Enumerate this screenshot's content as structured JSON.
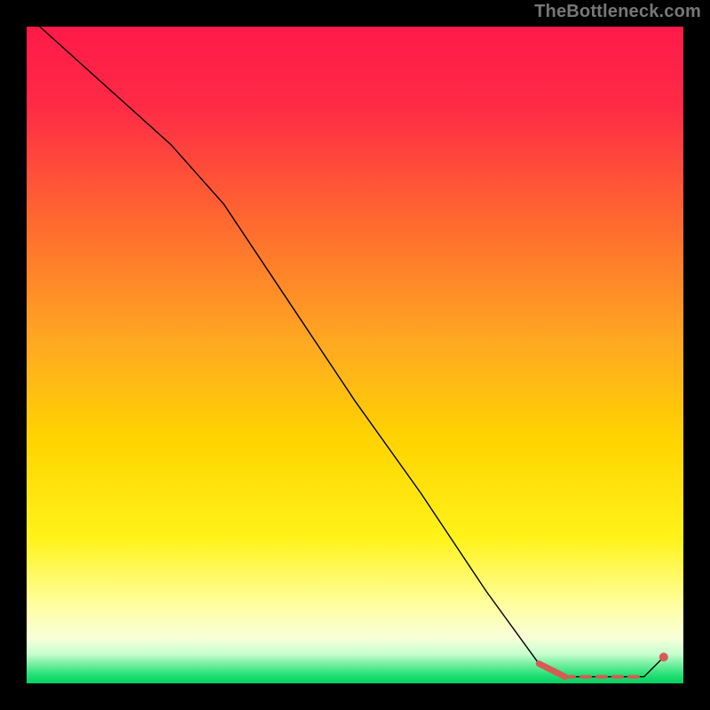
{
  "watermark": "TheBottleneck.com",
  "chart_data": {
    "type": "line",
    "title": "",
    "xlabel": "",
    "ylabel": "",
    "xlim": [
      0,
      100
    ],
    "ylim": [
      0,
      100
    ],
    "grid": false,
    "legend": false,
    "background_transition": {
      "from_color": "#ff1a48",
      "through_color": "#ffd400",
      "to_color": "#00e060",
      "bottom_band_approx_pct": 4
    },
    "series": [
      {
        "name": "curve",
        "type": "line",
        "x": [
          2,
          12,
          22,
          30,
          40,
          50,
          60,
          70,
          78,
          82,
          86,
          90,
          94,
          97
        ],
        "y": [
          100,
          91,
          82,
          73,
          58,
          43,
          29,
          14,
          3,
          1,
          1,
          1,
          1,
          4
        ],
        "stroke": "#000000",
        "stroke_width": 1.4
      },
      {
        "name": "highlight-thick-segment",
        "type": "line",
        "x": [
          78,
          82
        ],
        "y": [
          3,
          1
        ],
        "stroke": "#d85a55",
        "stroke_width": 7
      },
      {
        "name": "highlight-dashes",
        "type": "line",
        "x": [
          82,
          94
        ],
        "y": [
          1,
          1
        ],
        "stroke": "#d85a55",
        "stroke_width": 4,
        "dash": [
          10,
          8
        ]
      },
      {
        "name": "end-marker",
        "type": "scatter",
        "x": [
          97
        ],
        "y": [
          4
        ],
        "marker_color": "#d85a55",
        "marker_radius": 5
      }
    ]
  }
}
